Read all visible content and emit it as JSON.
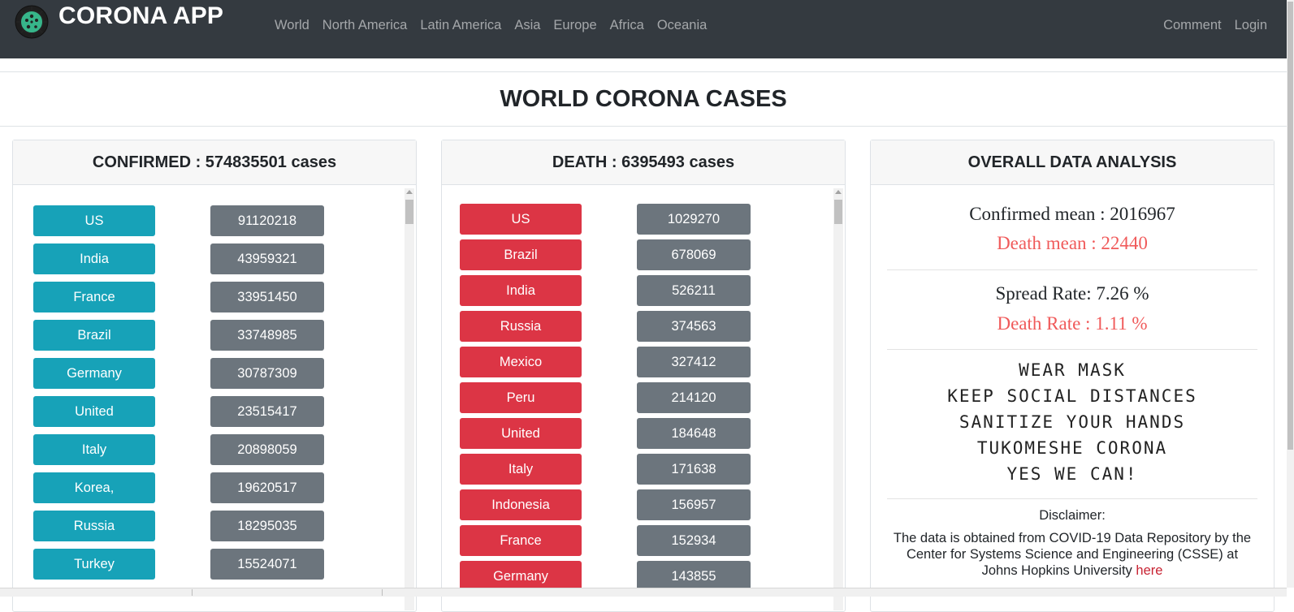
{
  "navbar": {
    "brand": "CORONA APP",
    "links": [
      "World",
      "North America",
      "Latin America",
      "Asia",
      "Europe",
      "Africa",
      "Oceania"
    ],
    "right_links": [
      "Comment",
      "Login"
    ]
  },
  "page_title": "WORLD CORONA CASES",
  "confirmed": {
    "header": "CONFIRMED : 574835501 cases",
    "rows": [
      {
        "country": "US",
        "value": "91120218"
      },
      {
        "country": "India",
        "value": "43959321"
      },
      {
        "country": "France",
        "value": "33951450"
      },
      {
        "country": "Brazil",
        "value": "33748985"
      },
      {
        "country": "Germany",
        "value": "30787309"
      },
      {
        "country": "United",
        "value": "23515417"
      },
      {
        "country": "Italy",
        "value": "20898059"
      },
      {
        "country": "Korea,",
        "value": "19620517"
      },
      {
        "country": "Russia",
        "value": "18295035"
      },
      {
        "country": "Turkey",
        "value": "15524071"
      }
    ]
  },
  "death": {
    "header": "DEATH : 6395493 cases",
    "rows": [
      {
        "country": "US",
        "value": "1029270"
      },
      {
        "country": "Brazil",
        "value": "678069"
      },
      {
        "country": "India",
        "value": "526211"
      },
      {
        "country": "Russia",
        "value": "374563"
      },
      {
        "country": "Mexico",
        "value": "327412"
      },
      {
        "country": "Peru",
        "value": "214120"
      },
      {
        "country": "United",
        "value": "184648"
      },
      {
        "country": "Italy",
        "value": "171638"
      },
      {
        "country": "Indonesia",
        "value": "156957"
      },
      {
        "country": "France",
        "value": "152934"
      },
      {
        "country": "Germany",
        "value": "143855"
      }
    ]
  },
  "analysis": {
    "header": "OVERALL DATA ANALYSIS",
    "confirmed_mean": "Confirmed mean : 2016967",
    "death_mean": "Death mean : 22440",
    "spread_rate": "Spread Rate: 7.26 %",
    "death_rate": "Death Rate : 1.11 %",
    "slogans": [
      "WEAR MASK",
      "KEEP SOCIAL DISTANCES",
      "SANITIZE YOUR HANDS",
      "TUKOMESHE CORONA",
      "YES WE CAN!"
    ],
    "disclaimer_title": "Disclaimer:",
    "disclaimer_text": "The data is obtained from COVID-19 Data Repository by the Center for Systems Science and Engineering (CSSE) at Johns Hopkins University",
    "disclaimer_link": "here"
  },
  "colors": {
    "navbar": "#343a40",
    "confirmed_pill": "#17a2b8",
    "death_pill": "#dc3545",
    "value_pill": "#6c757d",
    "death_text": "#f05a5a"
  },
  "icons": {
    "brand_logo": "virus-icon"
  }
}
